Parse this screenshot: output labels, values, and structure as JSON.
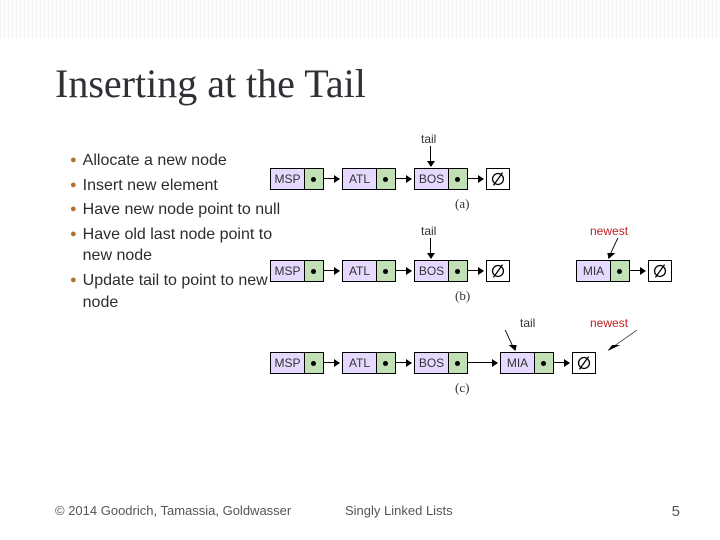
{
  "title": "Inserting at the Tail",
  "bullets": [
    "Allocate a new node",
    "Insert new element",
    "Have new node point to null",
    "Have old last node point to new node",
    "Update tail to point to new node"
  ],
  "footer": {
    "copyright": "© 2014 Goodrich, Tamassia, Goldwasser",
    "center": "Singly Linked Lists",
    "page": "5"
  },
  "diagram": {
    "labels": {
      "tail": "tail",
      "newest": "newest"
    },
    "rows": [
      {
        "nodes": [
          "MSP",
          "ATL",
          "BOS"
        ],
        "extraNodes": [],
        "caption": "(a)",
        "tailOver": 2,
        "newestOver": null,
        "trailingNull": true
      },
      {
        "nodes": [
          "MSP",
          "ATL",
          "BOS"
        ],
        "extraNodes": [
          "MIA"
        ],
        "caption": "(b)",
        "tailOver": 2,
        "newestOver": 3,
        "extraNull": true,
        "trailingNull": true
      },
      {
        "nodes": [
          "MSP",
          "ATL",
          "BOS",
          "MIA"
        ],
        "extraNodes": [],
        "caption": "(c)",
        "tailOver": 3,
        "newestOver": 3,
        "trailingNull": true
      }
    ]
  }
}
